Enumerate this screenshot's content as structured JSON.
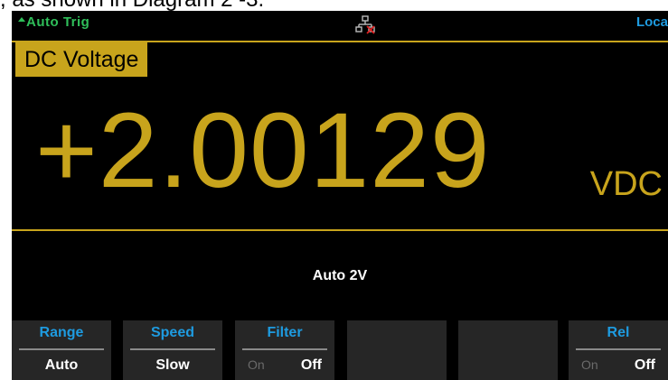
{
  "caption": ", as shown in Diagram 2 -3.",
  "status": {
    "trigger_icon": "up-arrow-icon",
    "trigger_mode": "Auto Trig",
    "network_icon": "network-disconnected-icon",
    "remote_state": "Loca"
  },
  "function_label": "DC Voltage",
  "reading": {
    "value": "+2.00129",
    "unit": "VDC"
  },
  "range_info": "Auto  2V",
  "softkeys": [
    {
      "title": "Range",
      "value": "Auto"
    },
    {
      "title": "Speed",
      "value": "Slow"
    },
    {
      "title": "Filter",
      "option_left": "On",
      "option_right": "Off",
      "selected": "Off"
    },
    {
      "title": "",
      "value": ""
    },
    {
      "title": "",
      "value": ""
    },
    {
      "title": "Rel",
      "option_left": "On",
      "option_right": "Off",
      "selected": "Off"
    }
  ],
  "colors": {
    "accent": "#c8a41c",
    "trigger": "#2fbf5a",
    "softkey_title": "#1e9be0",
    "background": "#000000"
  }
}
